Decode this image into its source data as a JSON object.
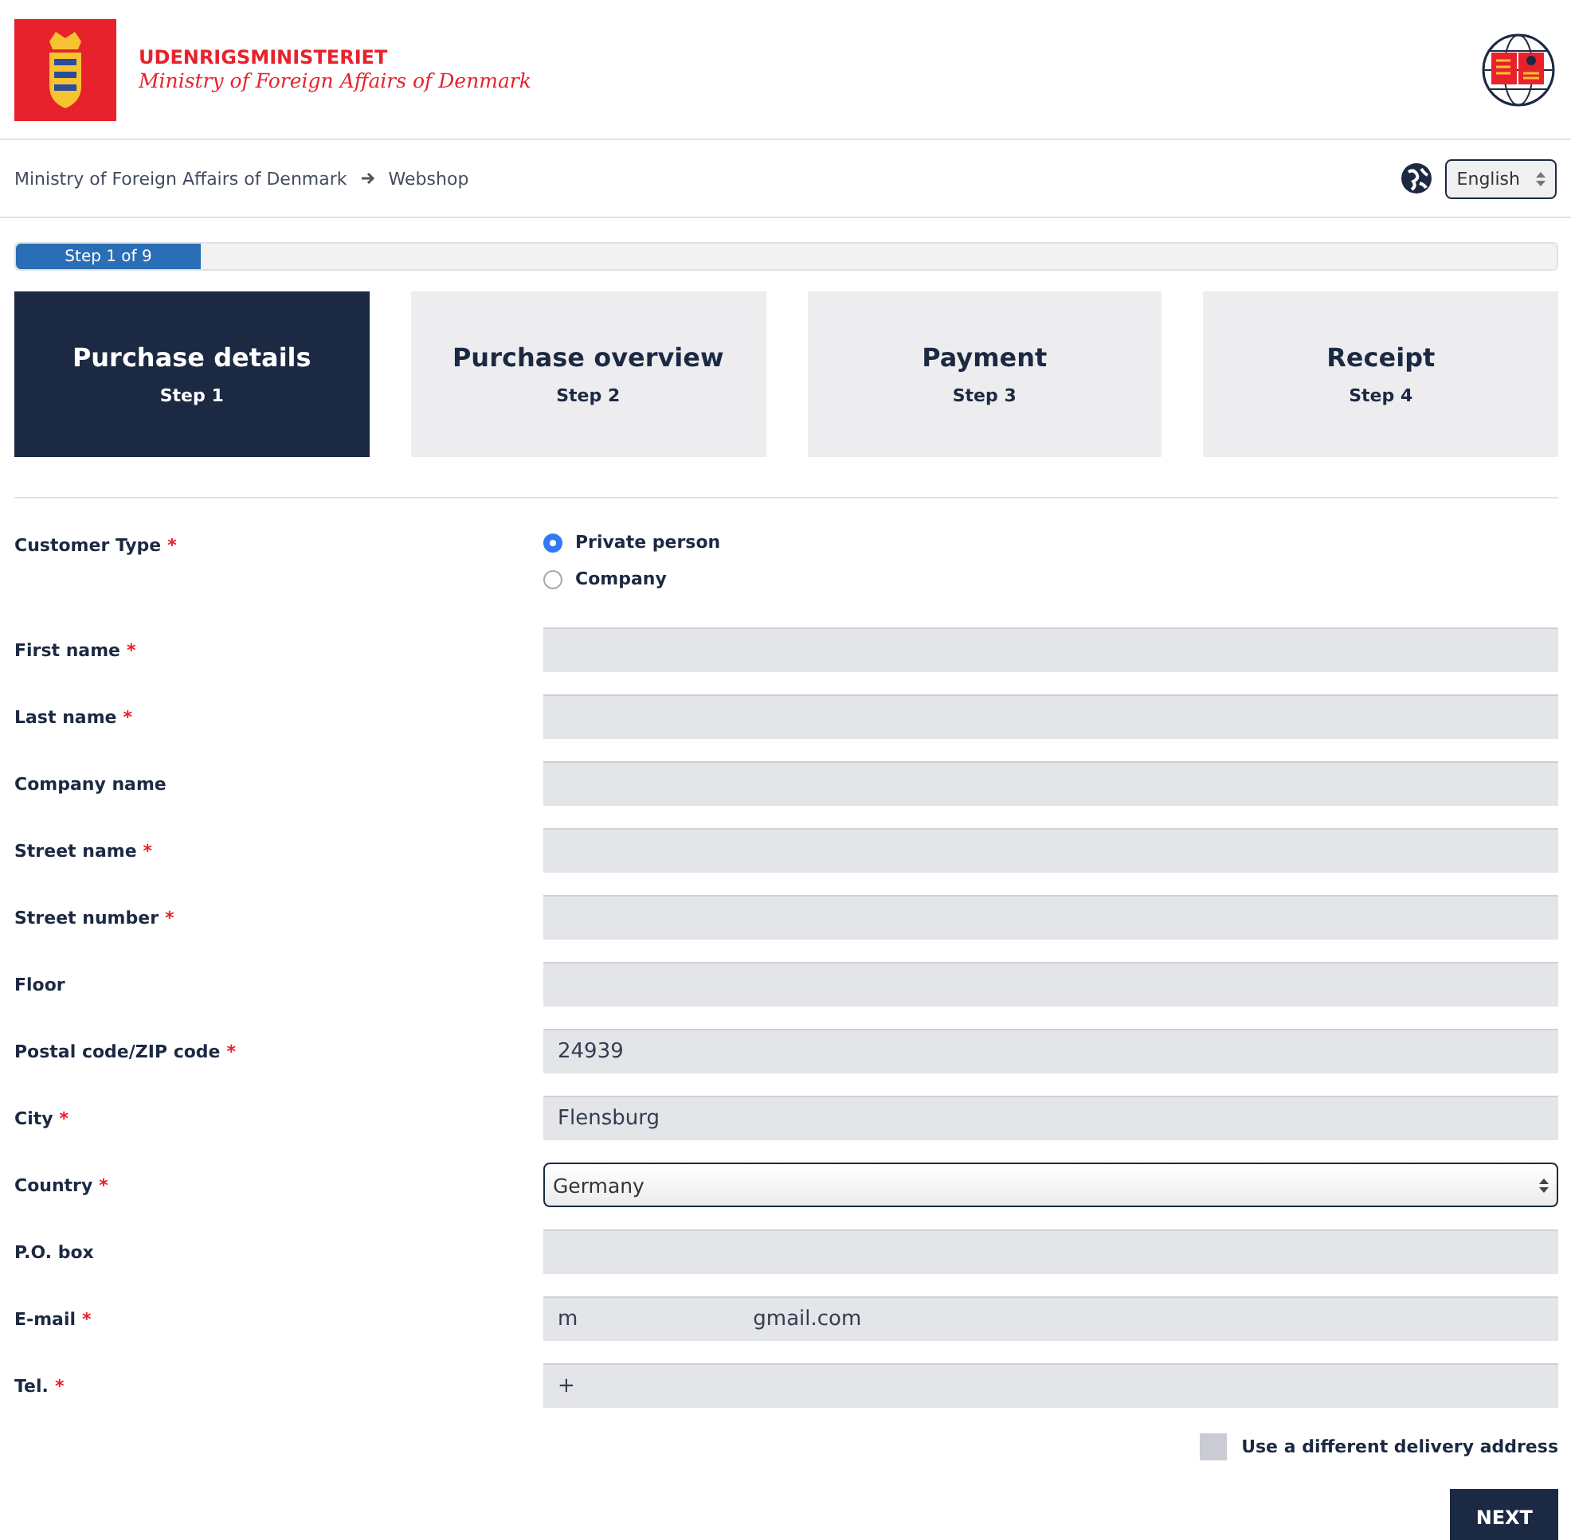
{
  "header": {
    "org_name": "UDENRIGSMINISTERIET",
    "org_subtitle": "Ministry of Foreign Affairs of Denmark"
  },
  "breadcrumb": {
    "items": [
      "Ministry of Foreign Affairs of Denmark",
      "Webshop"
    ],
    "language": "English"
  },
  "progress": {
    "label": "Step 1 of 9",
    "level": 0.12
  },
  "steps": [
    {
      "title": "Purchase details",
      "step": "Step 1",
      "selected": true
    },
    {
      "title": "Purchase overview",
      "step": "Step 2",
      "selected": false
    },
    {
      "title": "Payment",
      "step": "Step 3",
      "selected": false
    },
    {
      "title": "Receipt",
      "step": "Step 4",
      "selected": false
    }
  ],
  "customer_type": {
    "label": "Customer Type",
    "required_mark": "*",
    "options": [
      {
        "label": "Private person",
        "selected": true
      },
      {
        "label": "Company",
        "selected": false
      }
    ]
  },
  "fields": [
    {
      "label": "First name",
      "required_mark": "*",
      "kind": "text"
    },
    {
      "label": "Last name",
      "required_mark": "*",
      "kind": "text"
    },
    {
      "label": "Company name",
      "kind": "text"
    },
    {
      "label": "Street name",
      "required_mark": "*",
      "kind": "text"
    },
    {
      "label": "Street number",
      "required_mark": "*",
      "kind": "text"
    },
    {
      "label": "Floor",
      "kind": "text"
    },
    {
      "label": "Postal code/ZIP code",
      "required_mark": "*",
      "kind": "text",
      "value": [
        "24939"
      ]
    },
    {
      "label": "City",
      "required_mark": "*",
      "kind": "text",
      "value": [
        "Flensburg"
      ]
    },
    {
      "label": "Country",
      "required_mark": "*",
      "kind": "select",
      "value": [
        "Germany"
      ]
    },
    {
      "label": "P.O. box",
      "kind": "text"
    },
    {
      "label": "E-mail",
      "required_mark": "*",
      "kind": "text",
      "value": [
        "m",
        "gmail.com"
      ]
    },
    {
      "label": "Tel.",
      "required_mark": "*",
      "kind": "text",
      "value": [
        "+"
      ]
    }
  ],
  "delivery": {
    "label": "Use a different delivery address",
    "checked": false
  },
  "next_button": "NEXT"
}
